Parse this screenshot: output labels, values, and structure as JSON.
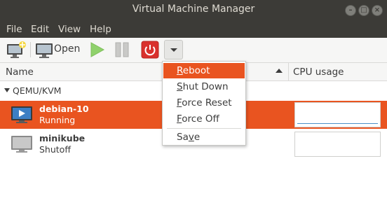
{
  "window": {
    "title": "Virtual Machine Manager",
    "controls": {
      "minimize": "–",
      "maximize": "□",
      "close": "×"
    }
  },
  "menubar": {
    "file": "File",
    "edit": "Edit",
    "view": "View",
    "help": "Help"
  },
  "toolbar": {
    "new_icon": "new-vm-icon",
    "open_label": "Open",
    "open_icon": "monitor-icon",
    "run_icon": "play-icon",
    "pause_icon": "pause-icon",
    "shutdown_icon": "power-icon",
    "dropdown_icon": "chevron-down-icon"
  },
  "columns": {
    "name": "Name",
    "cpu": "CPU usage"
  },
  "connection": {
    "label": "QEMU/KVM"
  },
  "vms": [
    {
      "name": "debian-10",
      "status": "Running",
      "selected": true
    },
    {
      "name": "minikube",
      "status": "Shutoff",
      "selected": false
    }
  ],
  "shutdown_menu": {
    "items": [
      {
        "pre": "",
        "mn": "R",
        "post": "eboot",
        "highlighted": true
      },
      {
        "pre": "",
        "mn": "S",
        "post": "hut Down",
        "highlighted": false
      },
      {
        "pre": "",
        "mn": "F",
        "post": "orce Reset",
        "highlighted": false
      },
      {
        "pre": "",
        "mn": "F",
        "post": "orce Off",
        "highlighted": false
      },
      {
        "pre": "Sa",
        "mn": "v",
        "post": "e",
        "highlighted": false
      }
    ]
  },
  "colors": {
    "accent": "#e95420",
    "titlebar": "#3c3b37",
    "run_green": "#8fd16b",
    "power_red": "#d9302c",
    "cpu_graph": "#4a90c8"
  }
}
